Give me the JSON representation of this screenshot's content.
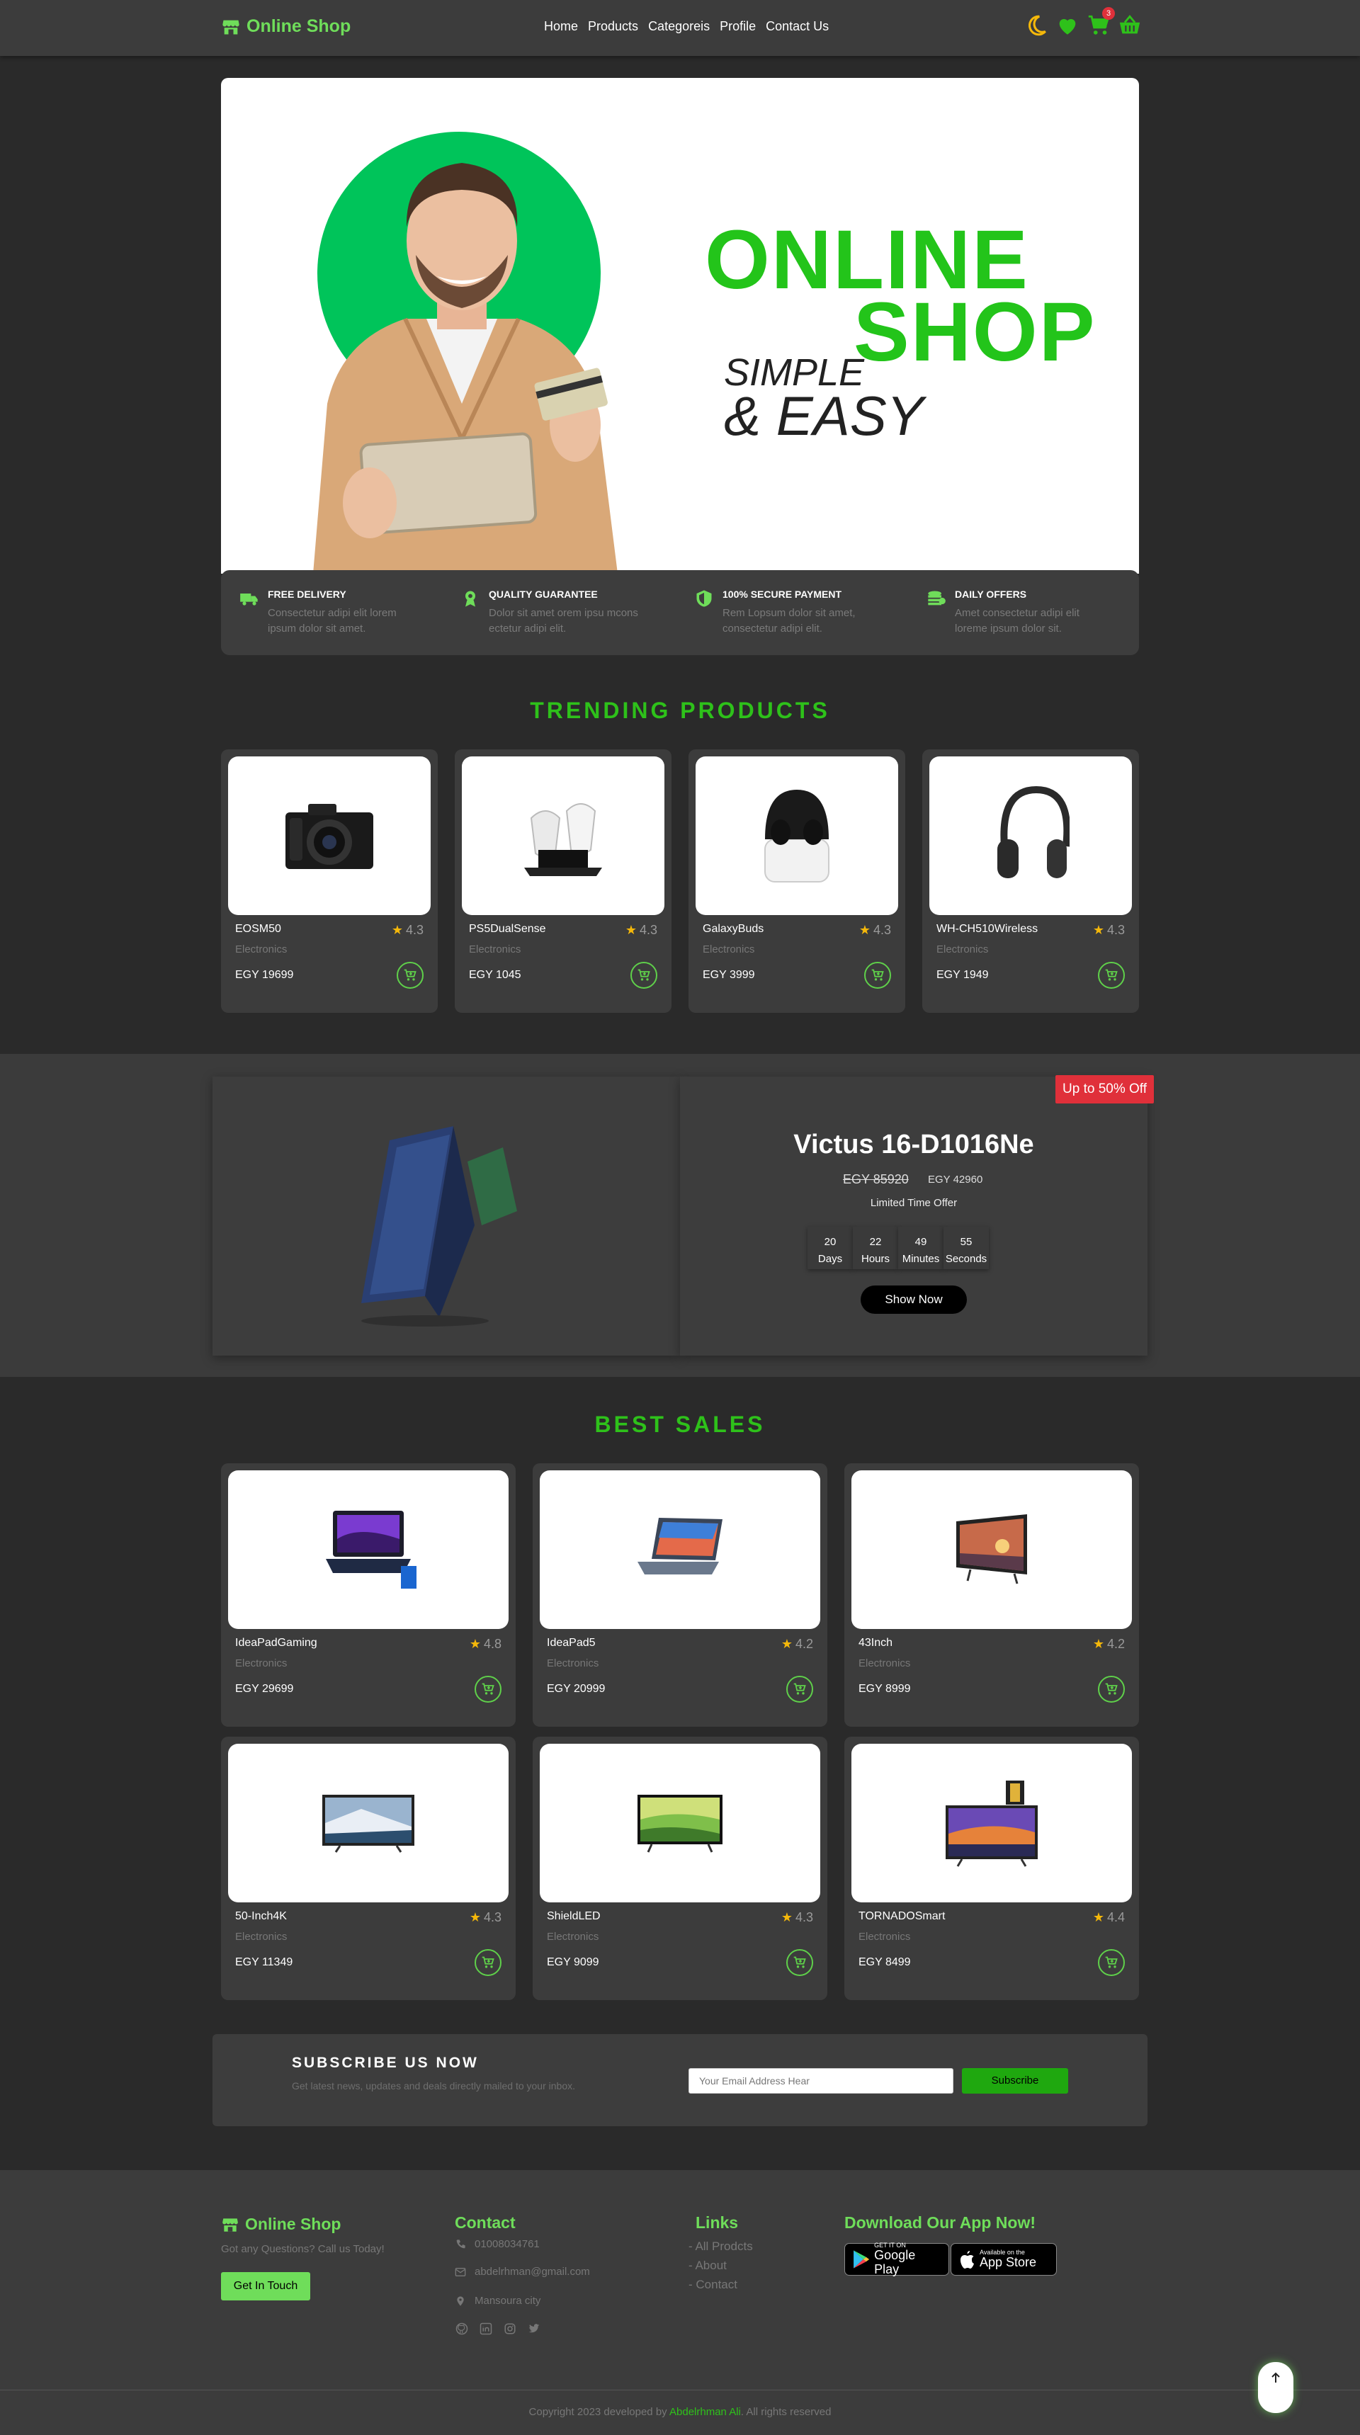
{
  "nav": {
    "brand": "Online Shop",
    "links": [
      "Home",
      "Products",
      "Categoreis",
      "Profile",
      "Contact Us"
    ],
    "cart_count": "3"
  },
  "hero": {
    "title_line1": "ONLINE",
    "title_line2": "SHOP",
    "sub_line1": "SIMPLE",
    "sub_line2": "& EASY"
  },
  "features": [
    {
      "icon": "truck-icon",
      "title": "FREE DELIVERY",
      "desc_line1": "Consectetur adipi elit lorem",
      "desc_line2": "ipsum dolor sit amet."
    },
    {
      "icon": "award-icon",
      "title": "QUALITY GUARANTEE",
      "desc_line1": "Dolor sit amet orem ipsu mcons",
      "desc_line2": "ectetur adipi elit."
    },
    {
      "icon": "shield-icon",
      "title": "100% SECURE PAYMENT",
      "desc_line1": "Rem Lopsum dolor sit amet,",
      "desc_line2": "consectetur adipi elit."
    },
    {
      "icon": "coins-icon",
      "title": "DAILY OFFERS",
      "desc_line1": "Amet consectetur adipi elit",
      "desc_line2": "loreme ipsum dolor sit."
    }
  ],
  "trending": {
    "title": "TRENDING PRODUCTS",
    "products": [
      {
        "name": "EOSM50",
        "rating": "4.3",
        "category": "Electronics",
        "price": "EGY 19699"
      },
      {
        "name": "PS5DualSense",
        "rating": "4.3",
        "category": "Electronics",
        "price": "EGY 1045"
      },
      {
        "name": "GalaxyBuds",
        "rating": "4.3",
        "category": "Electronics",
        "price": "EGY 3999"
      },
      {
        "name": "WH-CH510Wireless",
        "rating": "4.3",
        "category": "Electronics",
        "price": "EGY 1949"
      }
    ]
  },
  "offer": {
    "tag": "Up to 50% Off",
    "title": "Victus 16-D1016Ne",
    "old_price": "EGY 85920",
    "new_price": "EGY 42960",
    "limited": "Limited Time Offer",
    "countdown": [
      {
        "value": "20",
        "unit": "Days"
      },
      {
        "value": "22",
        "unit": "Hours"
      },
      {
        "value": "49",
        "unit": "Minutes"
      },
      {
        "value": "55",
        "unit": "Seconds"
      }
    ],
    "button": "Show Now"
  },
  "best": {
    "title": "BEST SALES",
    "products": [
      {
        "name": "IdeaPadGaming",
        "rating": "4.8",
        "category": "Electronics",
        "price": "EGY 29699"
      },
      {
        "name": "IdeaPad5",
        "rating": "4.2",
        "category": "Electronics",
        "price": "EGY 20999"
      },
      {
        "name": "43Inch",
        "rating": "4.2",
        "category": "Electronics",
        "price": "EGY 8999"
      },
      {
        "name": "50-Inch4K",
        "rating": "4.3",
        "category": "Electronics",
        "price": "EGY 11349"
      },
      {
        "name": "ShieldLED",
        "rating": "4.3",
        "category": "Electronics",
        "price": "EGY 9099"
      },
      {
        "name": "TORNADOSmart",
        "rating": "4.4",
        "category": "Electronics",
        "price": "EGY 8499"
      }
    ]
  },
  "subscribe": {
    "title": "SUBSCRIBE US NOW",
    "desc": "Get latest news, updates and deals directly mailed to your inbox.",
    "placeholder": "Your Email Address Hear",
    "button": "Subscribe"
  },
  "footer": {
    "brand": "Online Shop",
    "ask": "Got any Questions? Call us Today!",
    "button": "Get In Touch",
    "contact_title": "Contact",
    "phone": "01008034761",
    "email": "abdelrhman@gmail.com",
    "city": "Mansoura city",
    "links_title": "Links",
    "links": [
      "- All Prodcts",
      "- About",
      "- Contact"
    ],
    "app_title": "Download Our App Now!",
    "google_small": "GET IT ON",
    "google_big": "Google Play",
    "apple_small": "Available on the",
    "apple_big": "App Store",
    "copyright_pre": "Copyright 2023 developed by ",
    "copyright_name": "Abdelrhman Ali",
    "copyright_post": ". All rights reserved"
  },
  "colors": {
    "accent": "#2ec11a",
    "accent_light": "#6fdd5a",
    "background": "#2a2a2a",
    "card": "#3c3c3c",
    "sale_tag": "#e0303a"
  }
}
